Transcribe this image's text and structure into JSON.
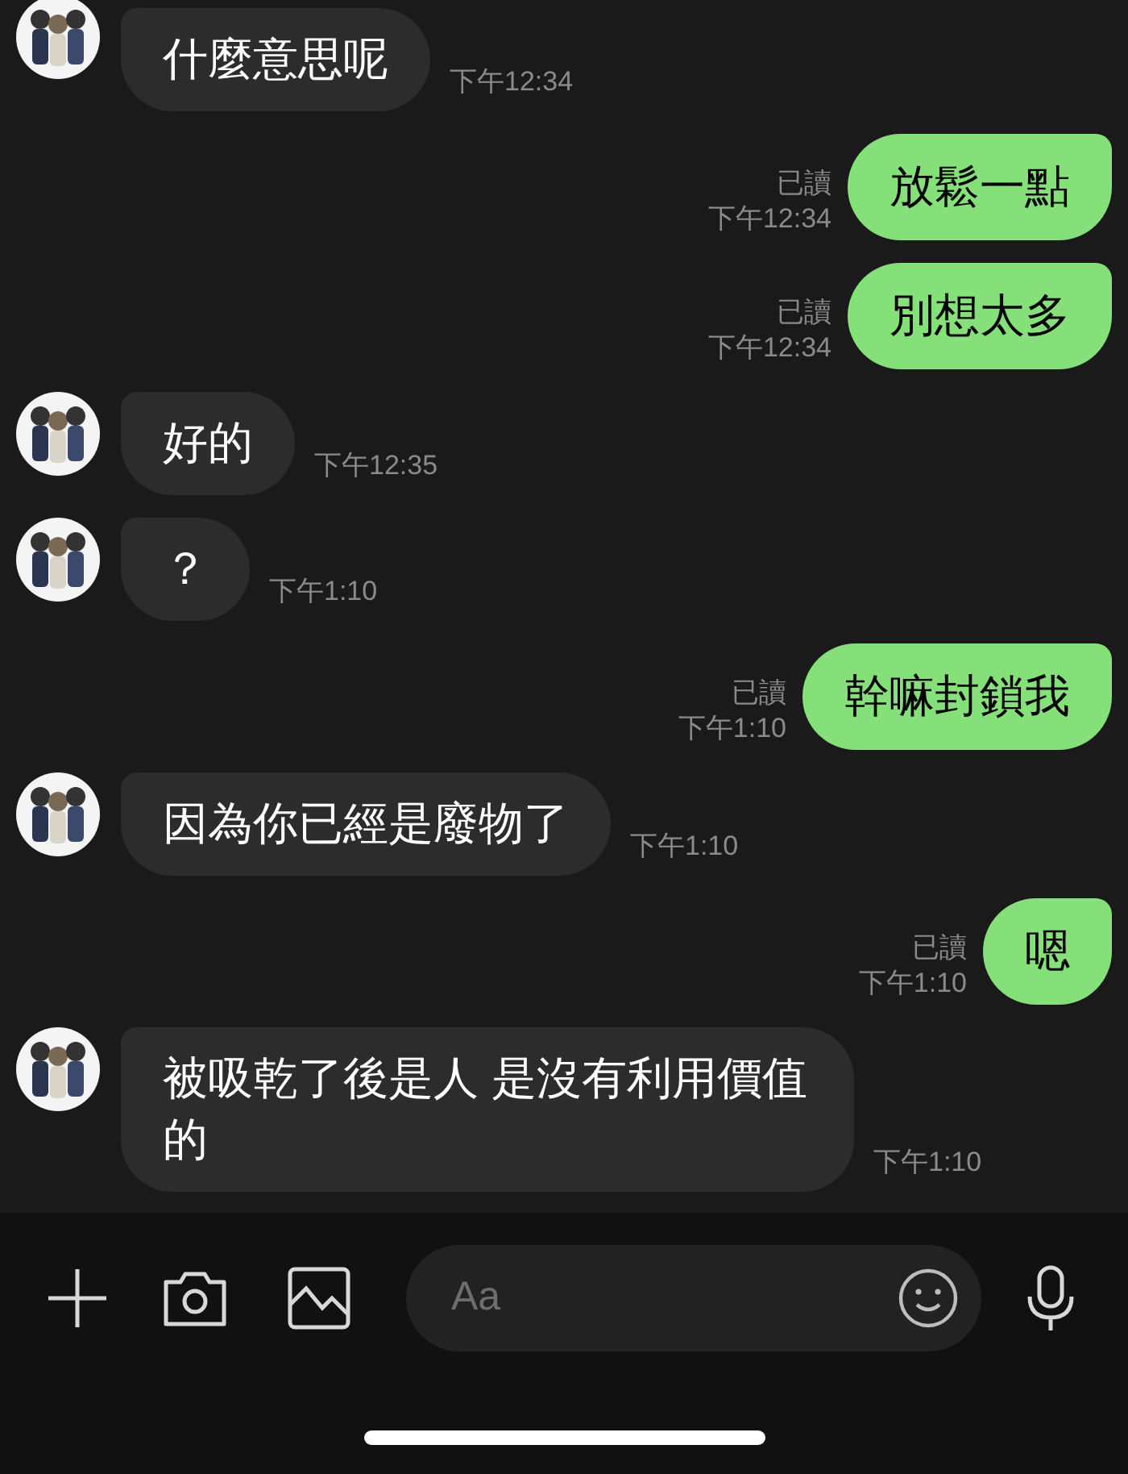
{
  "messages": [
    {
      "kind": "received",
      "text": "什麼意思呢",
      "time": "下午12:34"
    },
    {
      "kind": "sent",
      "text": "放鬆一點",
      "read": "已讀",
      "time": "下午12:34"
    },
    {
      "kind": "sent",
      "text": "別想太多",
      "read": "已讀",
      "time": "下午12:34"
    },
    {
      "kind": "received",
      "text": "好的",
      "time": "下午12:35"
    },
    {
      "kind": "received",
      "text": "？",
      "time": "下午1:10"
    },
    {
      "kind": "sent",
      "text": "幹嘛封鎖我",
      "read": "已讀",
      "time": "下午1:10"
    },
    {
      "kind": "received",
      "text": "因為你已經是廢物了",
      "time": "下午1:10"
    },
    {
      "kind": "sent",
      "text": "嗯",
      "read": "已讀",
      "time": "下午1:10"
    },
    {
      "kind": "received",
      "text": "被吸乾了後是人 是沒有利用價值的",
      "time": "下午1:10"
    }
  ],
  "input": {
    "placeholder": "Aa"
  }
}
